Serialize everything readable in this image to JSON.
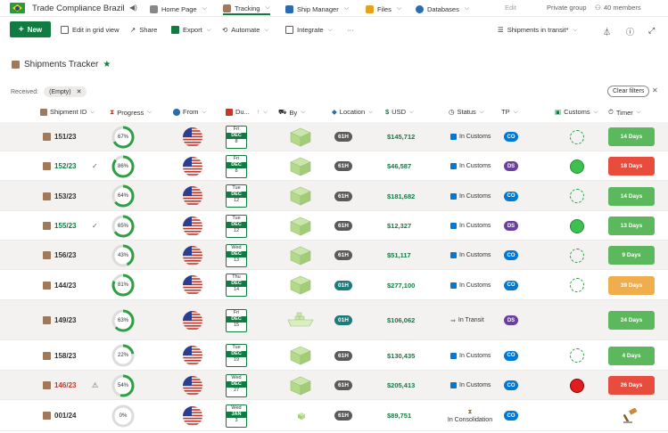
{
  "topnav": {
    "site_title": "Trade Compliance Brazil",
    "items": [
      {
        "label": "Home Page"
      },
      {
        "label": "Tracking"
      },
      {
        "label": "Ship Manager"
      },
      {
        "label": "Files"
      },
      {
        "label": "Databases"
      },
      {
        "label": "Edit"
      }
    ],
    "private_group": "Private group",
    "members": "40 members"
  },
  "commandbar": {
    "new_label": "New",
    "edit_grid": "Edit in grid view",
    "share": "Share",
    "export": "Export",
    "automate": "Automate",
    "integrate": "Integrate",
    "more": "···",
    "view_name": "Shipments in transit*"
  },
  "list": {
    "title": "Shipments Tracker",
    "filter_label": "Received:",
    "filter_value": "(Empty)",
    "clear_filters": "Clear filters"
  },
  "columns": {
    "shipment_id": "Shipment ID",
    "progress": "Progress",
    "from": "From",
    "due": "Du...",
    "by": "By",
    "location": "Location",
    "usd": "USD",
    "status": "Status",
    "tp": "TP",
    "customs": "Customs",
    "timer": "Timer"
  },
  "rows": [
    {
      "id": "151/23",
      "id_color": "#323130",
      "check": "",
      "progress": 67,
      "progress_label": "67%",
      "due_dow": "Fri",
      "due_mon": "DEC",
      "due_day": "8",
      "by": "box",
      "location": "61H",
      "loc_color": "#5a5a5a",
      "usd": "$145,712",
      "status": "In Customs",
      "tp": "CO",
      "tp_color": "#0078d4",
      "customs": "ring",
      "timer": "14 Days",
      "timer_color": "#5cb85c"
    },
    {
      "id": "152/23",
      "id_color": "#107c41",
      "check": "✓",
      "progress": 86,
      "progress_label": "86%",
      "due_dow": "Fri",
      "due_mon": "DEC",
      "due_day": "8",
      "by": "box",
      "location": "61H",
      "loc_color": "#5a5a5a",
      "usd": "$46,587",
      "status": "In Customs",
      "tp": "DS",
      "tp_color": "#6b3fa0",
      "customs": "green",
      "timer": "18 Days",
      "timer_color": "#e74c3c"
    },
    {
      "id": "153/23",
      "id_color": "#323130",
      "check": "",
      "progress": 64,
      "progress_label": "64%",
      "due_dow": "Tue",
      "due_mon": "DEC",
      "due_day": "12",
      "by": "box",
      "location": "61H",
      "loc_color": "#5a5a5a",
      "usd": "$181,682",
      "status": "In Customs",
      "tp": "CO",
      "tp_color": "#0078d4",
      "customs": "ring",
      "timer": "14 Days",
      "timer_color": "#5cb85c"
    },
    {
      "id": "155/23",
      "id_color": "#107c41",
      "check": "✓",
      "progress": 65,
      "progress_label": "65%",
      "due_dow": "Tue",
      "due_mon": "DEC",
      "due_day": "12",
      "by": "box",
      "location": "61H",
      "loc_color": "#5a5a5a",
      "usd": "$12,327",
      "status": "In Customs",
      "tp": "DS",
      "tp_color": "#6b3fa0",
      "customs": "green",
      "timer": "13 Days",
      "timer_color": "#5cb85c"
    },
    {
      "id": "156/23",
      "id_color": "#323130",
      "check": "",
      "progress": 43,
      "progress_label": "43%",
      "due_dow": "Wed",
      "due_mon": "DEC",
      "due_day": "13",
      "by": "box",
      "location": "61H",
      "loc_color": "#5a5a5a",
      "usd": "$51,117",
      "status": "In Customs",
      "tp": "CO",
      "tp_color": "#0078d4",
      "customs": "ring",
      "timer": "9 Days",
      "timer_color": "#5cb85c"
    },
    {
      "id": "144/23",
      "id_color": "#323130",
      "check": "",
      "progress": 81,
      "progress_label": "81%",
      "due_dow": "Thu",
      "due_mon": "DEC",
      "due_day": "14",
      "by": "box",
      "location": "01H",
      "loc_color": "#1f7a7a",
      "usd": "$277,100",
      "status": "In Customs",
      "tp": "CO",
      "tp_color": "#0078d4",
      "customs": "ring",
      "timer": "39 Days",
      "timer_color": "#f0ad4e"
    },
    {
      "id": "149/23",
      "id_color": "#323130",
      "check": "",
      "progress": 63,
      "progress_label": "63%",
      "due_dow": "Fri",
      "due_mon": "DEC",
      "due_day": "15",
      "by": "ship",
      "location": "01H",
      "loc_color": "#1f7a7a",
      "usd": "$106,062",
      "status": "In Transit",
      "tp": "DS",
      "tp_color": "#6b3fa0",
      "customs": "none",
      "timer": "24 Days",
      "timer_color": "#5cb85c"
    },
    {
      "id": "158/23",
      "id_color": "#323130",
      "check": "",
      "progress": 22,
      "progress_label": "22%",
      "due_dow": "Tue",
      "due_mon": "DEC",
      "due_day": "19",
      "by": "box",
      "location": "61H",
      "loc_color": "#5a5a5a",
      "usd": "$130,435",
      "status": "In Customs",
      "tp": "CO",
      "tp_color": "#0078d4",
      "customs": "ring",
      "timer": "4 Days",
      "timer_color": "#5cb85c"
    },
    {
      "id": "146/23",
      "id_color": "#c0392b",
      "check": "⚠",
      "progress": 54,
      "progress_label": "54%",
      "due_dow": "Wed",
      "due_mon": "DEC",
      "due_day": "27",
      "by": "box",
      "location": "61H",
      "loc_color": "#5a5a5a",
      "usd": "$205,413",
      "status": "In Customs",
      "tp": "CO",
      "tp_color": "#0078d4",
      "customs": "red",
      "timer": "26 Days",
      "timer_color": "#e74c3c"
    },
    {
      "id": "001/24",
      "id_color": "#323130",
      "check": "",
      "progress": 0,
      "progress_label": "0%",
      "due_dow": "Wed",
      "due_mon": "JAN",
      "due_day": "3",
      "by": "small",
      "location": "61H",
      "loc_color": "#5a5a5a",
      "usd": "$89,751",
      "status": "In Consolidation",
      "tp": "CO",
      "tp_color": "#0078d4",
      "customs": "none",
      "timer": "",
      "timer_color": "none"
    }
  ],
  "colors": {
    "accent": "#107c41",
    "progress_green": "#2ea043",
    "progress_track": "#dcdcdc"
  }
}
